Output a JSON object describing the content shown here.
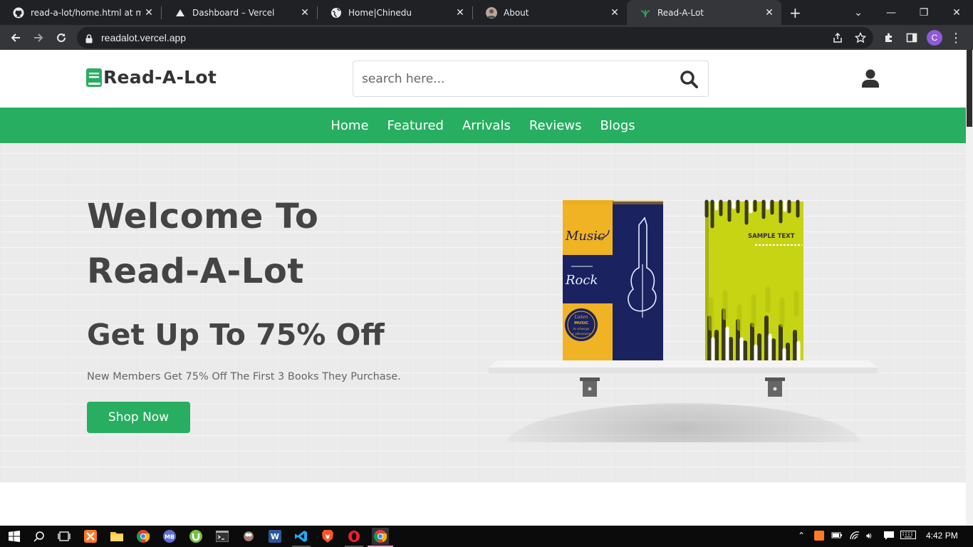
{
  "browser": {
    "tabs": [
      {
        "title": "read-a-lot/home.html at main",
        "icon": "github-icon",
        "active": false
      },
      {
        "title": "Dashboard – Vercel",
        "icon": "vercel-icon",
        "active": false
      },
      {
        "title": "Home|Chinedu",
        "icon": "globe-icon",
        "active": false
      },
      {
        "title": "About",
        "icon": "profile-photo-icon",
        "active": false
      },
      {
        "title": "Read-A-Lot",
        "icon": "leaf-icon",
        "active": true
      }
    ],
    "url": "readalot.vercel.app",
    "profile_initial": "C",
    "profile_color": "#8e5bd6"
  },
  "site": {
    "logo_text": "Read-A-Lot",
    "search_placeholder": "search here...",
    "nav": [
      "Home",
      "Featured",
      "Arrivals",
      "Reviews",
      "Blogs"
    ],
    "accent_color": "#27ae60"
  },
  "hero": {
    "title_line1": "Welcome To",
    "title_line2": "Read-A-Lot",
    "offer": "Get Up To 75% Off",
    "description": "New Members Get 75% Off The First 3 Books They Purchase.",
    "cta": "Shop Now"
  },
  "books": {
    "book1": {
      "text_music": "Music",
      "text_rock": "Rock",
      "badge_line1": "Listen",
      "badge_line2": "MUSIC",
      "badge_line3": "is always",
      "badge_line4": "a pleasure"
    },
    "book2": {
      "text": "SAMPLE TEXT"
    }
  },
  "taskbar": {
    "apps": [
      "start-icon",
      "search-icon",
      "task-view-icon",
      "xampp-icon",
      "file-explorer-icon",
      "chrome-icon",
      "mb-icon",
      "utorrent-icon",
      "cmd-icon",
      "gimp-icon",
      "word-icon",
      "vscode-icon",
      "brave-icon",
      "opera-icon",
      "chrome-active-icon"
    ],
    "clock": "4:42 PM"
  }
}
